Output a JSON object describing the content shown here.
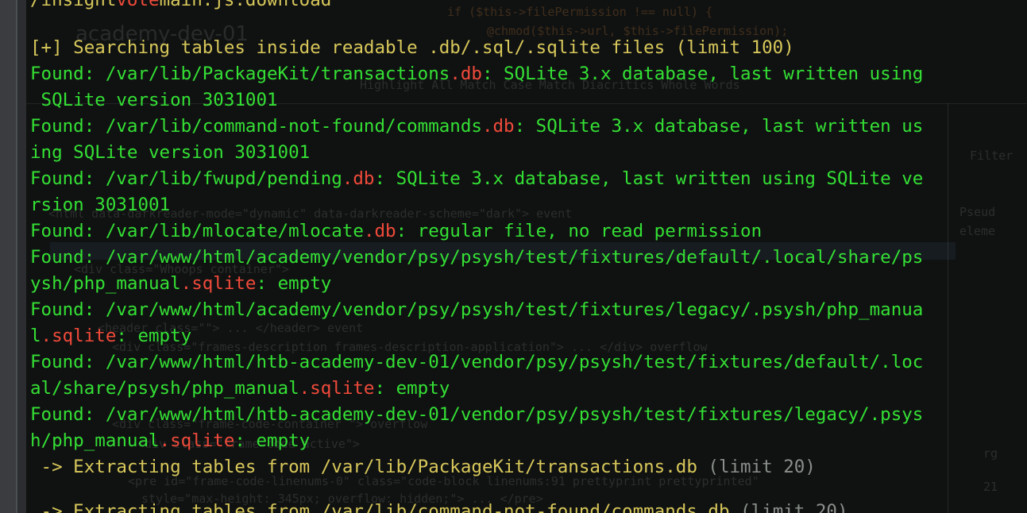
{
  "terminal": {
    "top_partial": {
      "pre": "/insight",
      "mid": "vote",
      "post": "main.js.download"
    },
    "search_header": {
      "marker": "[+]",
      "text": " Searching tables inside readable .db/.sql/.sqlite files (limit 100)"
    },
    "found_lines": [
      {
        "l1a": "Found: /var/lib/PackageKit/transactions",
        "l1ext": ".db",
        "l1b": ": SQLite 3.x database, last written using",
        "l2a": " SQLite version 3031001",
        "l2ext": "",
        "l2b": ""
      },
      {
        "l1a": "Found: /var/lib/command-not-found/commands",
        "l1ext": ".db",
        "l1b": ": SQLite 3.x database, last written us",
        "l2a": "ing SQLite version 3031001",
        "l2ext": "",
        "l2b": ""
      },
      {
        "l1a": "Found: /var/lib/fwupd/pending",
        "l1ext": ".db",
        "l1b": ": SQLite 3.x database, last written using SQLite ve",
        "l2a": "rsion 3031001",
        "l2ext": "",
        "l2b": ""
      },
      {
        "l1a": "Found: /var/lib/mlocate/mlocate",
        "l1ext": ".db",
        "l1b": ": regular file, no read permission"
      },
      {
        "l1a": "Found: /var/www/html/academy/vendor/psy/psysh/test/fixtures/default/.local/share/ps",
        "l1ext": "",
        "l1b": "",
        "l2a": "ysh/php_manual",
        "l2ext": ".sqlite",
        "l2b": ": empty"
      },
      {
        "l1a": "Found: /var/www/html/academy/vendor/psy/psysh/test/fixtures/legacy/.psysh/php_manua",
        "l1ext": "",
        "l1b": "",
        "l2a": "l",
        "l2ext": ".sqlite",
        "l2b": ": empty"
      },
      {
        "l1a": "Found: /var/www/html/htb-academy-dev-01/vendor/psy/psysh/test/fixtures/default/.loc",
        "l1ext": "",
        "l1b": "",
        "l2a": "al/share/psysh/php_manual",
        "l2ext": ".sqlite",
        "l2b": ": empty"
      },
      {
        "l1a": "Found: /var/www/html/htb-academy-dev-01/vendor/psy/psysh/test/fixtures/legacy/.psys",
        "l1ext": "",
        "l1b": "",
        "l2a": "h/php_manual",
        "l2ext": ".sqlite",
        "l2b": ": empty"
      }
    ],
    "extracting_1": {
      "arrow": " -> Extracting tables from ",
      "path": "/var/lib/PackageKit/transactions.db",
      "limit": " (limit 20)"
    },
    "extracting_2_partial": {
      "arrow": " -> Extracting tables from ",
      "path": "/var/lib/command-not-found/commands.db",
      "limit": " (limit 20)"
    }
  },
  "background_ghost": {
    "text_1": "academy-dev-01",
    "text_2": "if ($this->filePermission !== null) {",
    "text_3": "@chmod($this->url, $this->filePermission);",
    "text_4": "Highlight All   Match Case   Match Diacritics   Whole Words",
    "text_5": "<html data-darkreader-mode=\"dynamic\" data-darkreader-scheme=\"dark\"> event",
    "text_6": "<div class=\"Whoops container\">",
    "text_7": "<header class=\"\"> ... </header> event",
    "text_8": "<div class=\"frames-description frames-description-application\"> ... </div> overflow",
    "text_9": "<div class=\"frame-code-container \"> overflow",
    "text_10": "<div class=\"frame-code active\">",
    "text_11": "<pre id=\"frame-code-linenums-0\" class=\"code-block linenums:91 prettyprint prettyprinted\"",
    "text_12": "style=\"max-height: 345px; overflow: hidden;\"> ... </pre>",
    "side_1": "Filter",
    "side_2": "Pseud",
    "side_3": "eleme",
    "side_4": "rg",
    "side_5": "21"
  }
}
